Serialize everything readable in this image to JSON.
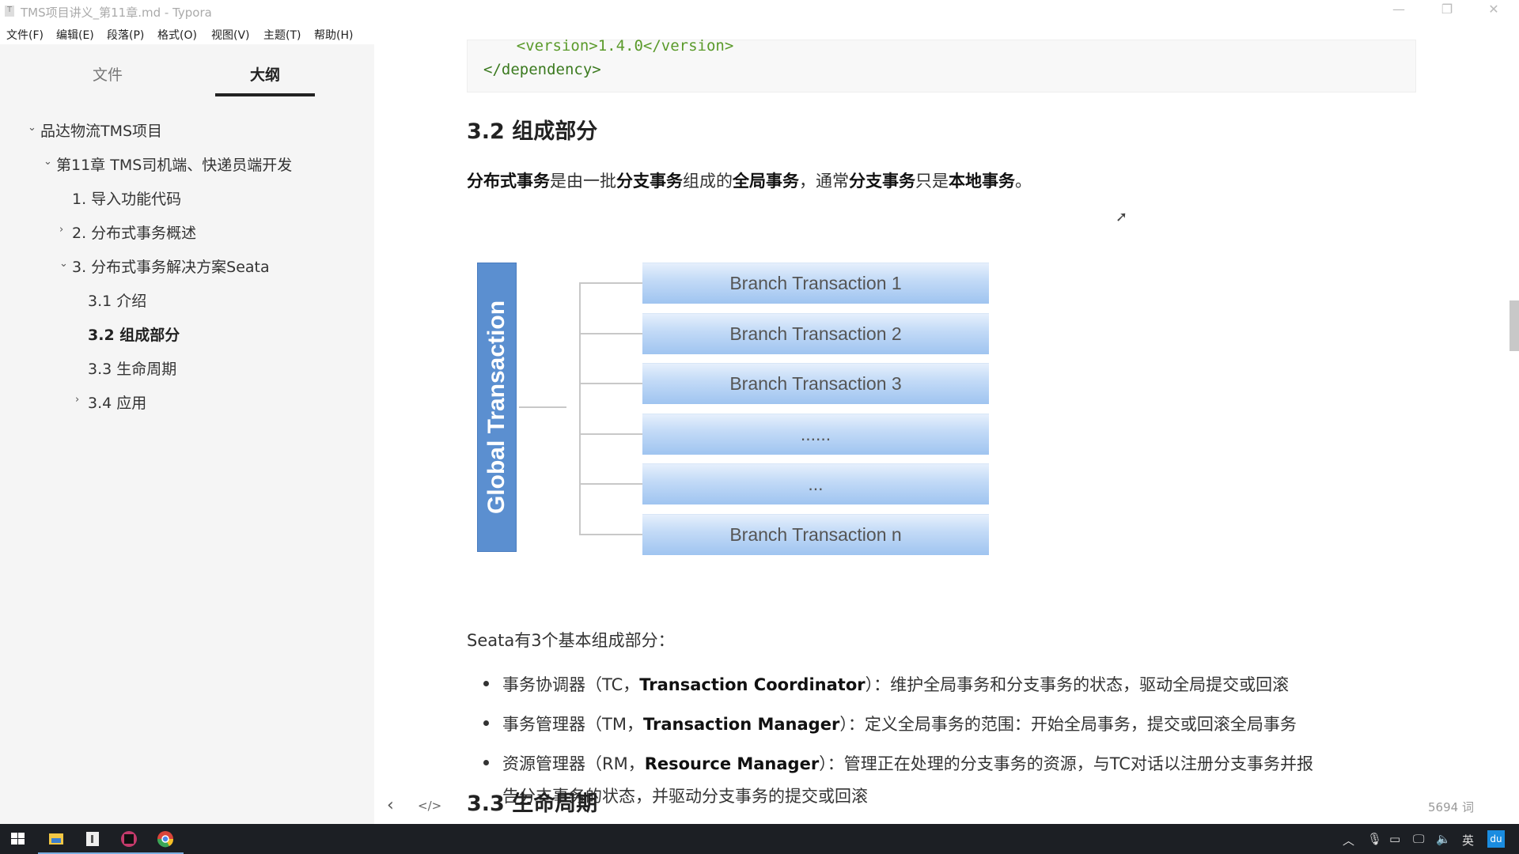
{
  "window": {
    "title": "TMS项目讲义_第11章.md - Typora",
    "minimize": "—",
    "maximize": "❐",
    "close": "✕"
  },
  "menu": [
    "文件(F)",
    "编辑(E)",
    "段落(P)",
    "格式(O)",
    "视图(V)",
    "主题(T)",
    "帮助(H)"
  ],
  "sidebar": {
    "tabs": [
      {
        "label": "文件",
        "active": false
      },
      {
        "label": "大纲",
        "active": true
      }
    ],
    "outline": [
      {
        "label": "品达物流TMS项目",
        "level": 0,
        "arrow": "expanded"
      },
      {
        "label": "第11章 TMS司机端、快递员端开发",
        "level": 1,
        "arrow": "expanded"
      },
      {
        "label": "1. 导入功能代码",
        "level": 2,
        "arrow": "none"
      },
      {
        "label": "2. 分布式事务概述",
        "level": 2,
        "arrow": "collapsed"
      },
      {
        "label": "3. 分布式事务解决方案Seata",
        "level": 2,
        "arrow": "expanded"
      },
      {
        "label": "3.1 介绍",
        "level": 3,
        "arrow": "none"
      },
      {
        "label": "3.2 组成部分",
        "level": 3,
        "arrow": "none",
        "active": true
      },
      {
        "label": "3.3 生命周期",
        "level": 3,
        "arrow": "none"
      },
      {
        "label": "3.4 应用",
        "level": 3,
        "arrow": "collapsed"
      }
    ]
  },
  "doc": {
    "code_lines": [
      "    <version>1.4.0</version>",
      "</dependency>"
    ],
    "heading_32": "3.2 组成部分",
    "intro": [
      {
        "t": "分布式事务",
        "b": true
      },
      {
        "t": "是由一批",
        "b": false
      },
      {
        "t": "分支事务",
        "b": true
      },
      {
        "t": "组成的",
        "b": false
      },
      {
        "t": "全局事务",
        "b": true
      },
      {
        "t": "，通常",
        "b": false
      },
      {
        "t": "分支事务",
        "b": true
      },
      {
        "t": "只是",
        "b": false
      },
      {
        "t": "本地事务",
        "b": true
      },
      {
        "t": "。",
        "b": false
      }
    ],
    "diagram": {
      "global": "Global Transaction",
      "branches": [
        "Branch Transaction 1",
        "Branch Transaction 2",
        "Branch Transaction 3",
        "......",
        "...",
        "Branch Transaction n"
      ]
    },
    "seata_intro": "Seata有3个基本组成部分：",
    "bullets": [
      {
        "pre": "事务协调器（TC，",
        "bold": "Transaction Coordinator",
        "post": "）：维护全局事务和分支事务的状态，驱动全局提交或回滚",
        "cont": ""
      },
      {
        "pre": "事务管理器（TM，",
        "bold": "Transaction Manager",
        "post": "）：定义全局事务的范围：开始全局事务，提交或回滚全局事务",
        "cont": ""
      },
      {
        "pre": "资源管理器（RM，",
        "bold": "Resource Manager",
        "post": "）：管理正在处理的分支事务的资源，与TC对话以注册分支事务并报",
        "cont": "告分支事务的状态，并驱动分支事务的提交或回滚"
      }
    ],
    "heading_33": "3.3 生命周期"
  },
  "footer": {
    "back": "‹",
    "source_toggle": "</>",
    "word_count": "5694 词"
  },
  "taskbar": {
    "tray_lang": "英",
    "tray_ime": "du"
  }
}
